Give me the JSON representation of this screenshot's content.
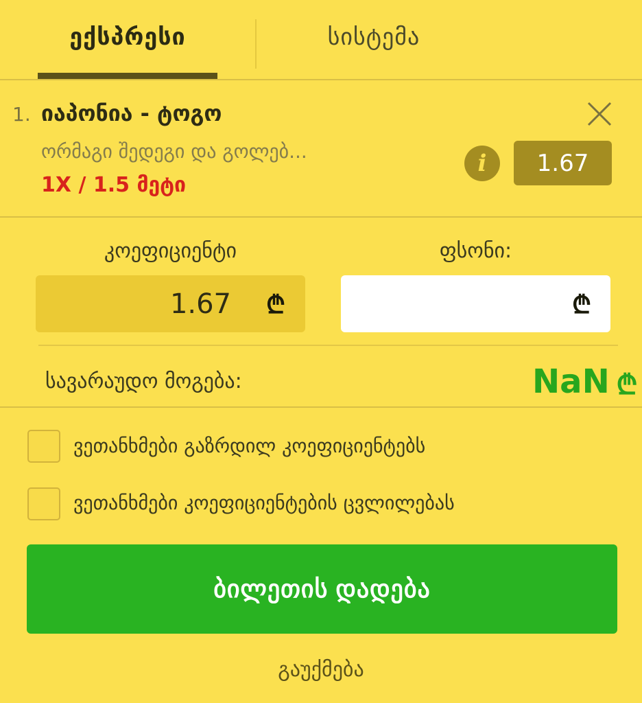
{
  "tabs": [
    {
      "label": "ექსპრესი",
      "active": true
    },
    {
      "label": "სისტემა",
      "active": false
    }
  ],
  "bet": {
    "index": "1.",
    "match": "იაპონია - ტოგო",
    "market": "ორმაგი შედეგი და გოლებ...",
    "pick": "1X / 1.5 მეტი",
    "odds": "1.67"
  },
  "coefficient": {
    "label": "კოეფიციენტი",
    "value": "1.67"
  },
  "stake": {
    "label": "ფსონი:",
    "value": "",
    "placeholder": ""
  },
  "currency_symbol": "₾",
  "winnings": {
    "label": "სავარაუდო მოგება:",
    "value": "NaN"
  },
  "checkboxes": [
    {
      "label": "ვეთანხმები გაზრდილ კოეფიციენტებს",
      "checked": false
    },
    {
      "label": "ვეთანხმები კოეფიციენტების ცვლილებას",
      "checked": false
    }
  ],
  "submit_label": "ბილეთის დადება",
  "cancel_label": "გაუქმება",
  "colors": {
    "background": "#fbe04f",
    "accent_dark": "#a48d21",
    "pick_red": "#d8231c",
    "winnings_green": "#28a61e",
    "submit_green": "#29b322"
  }
}
